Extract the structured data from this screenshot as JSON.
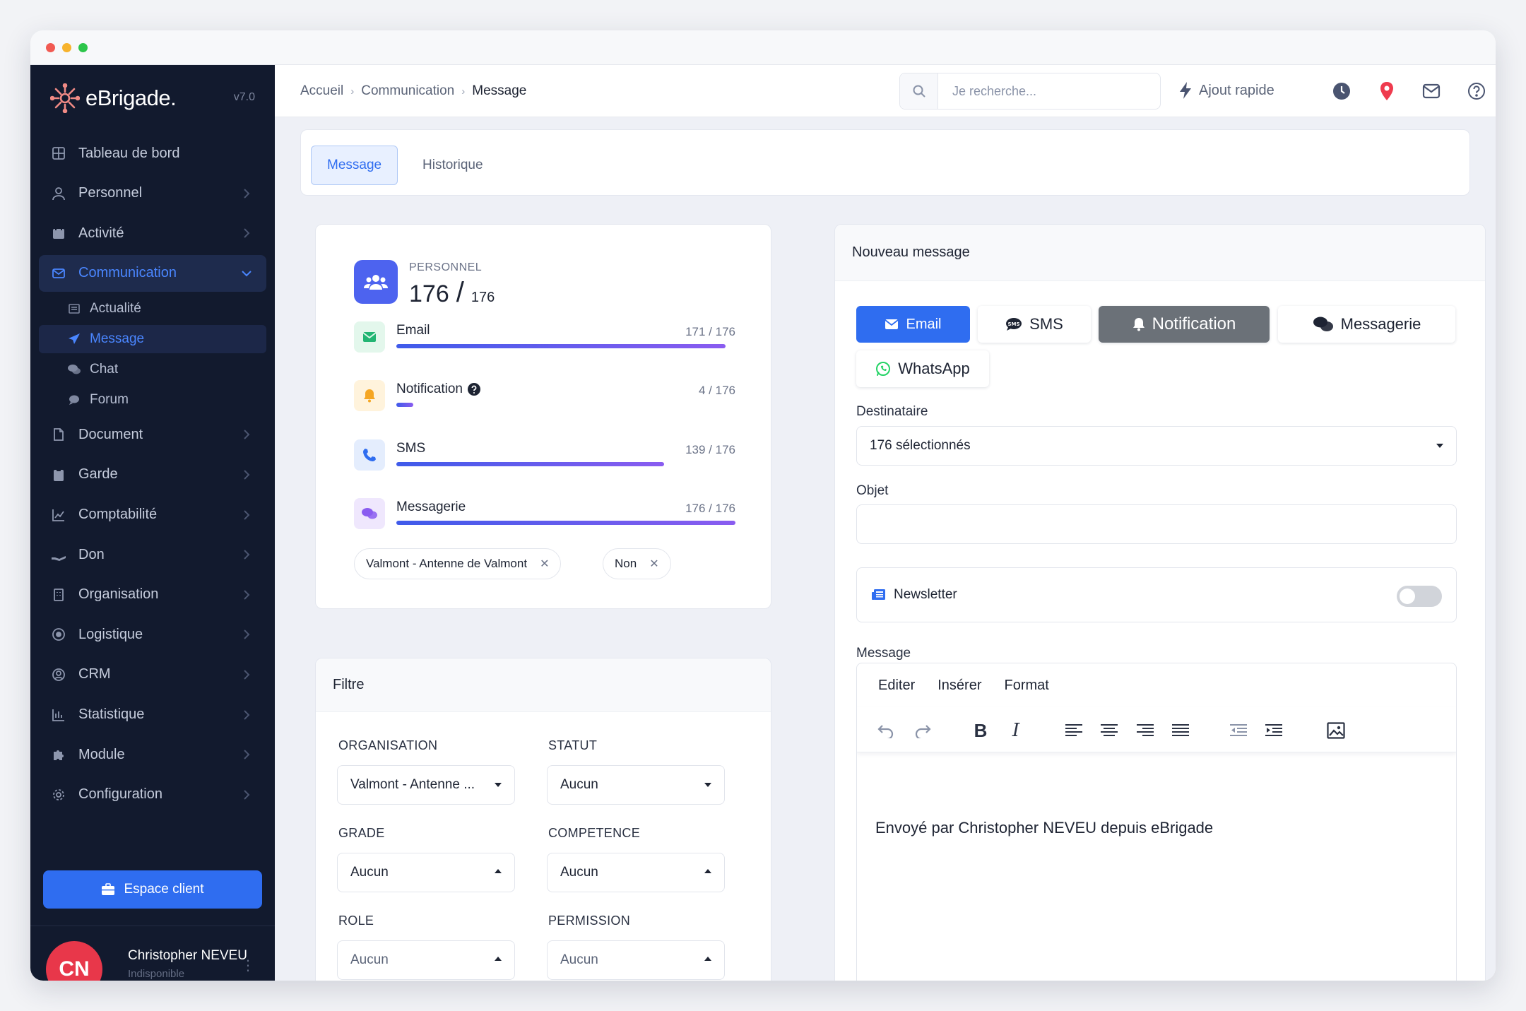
{
  "app": {
    "logo_text": "eBrigade.",
    "version": "v7.0"
  },
  "sidebar": {
    "items": [
      {
        "label": "Tableau de bord"
      },
      {
        "label": "Personnel"
      },
      {
        "label": "Activité"
      },
      {
        "label": "Communication"
      },
      {
        "label": "Document"
      },
      {
        "label": "Garde"
      },
      {
        "label": "Comptabilité"
      },
      {
        "label": "Don"
      },
      {
        "label": "Organisation"
      },
      {
        "label": "Logistique"
      },
      {
        "label": "CRM"
      },
      {
        "label": "Statistique"
      },
      {
        "label": "Module"
      },
      {
        "label": "Configuration"
      }
    ],
    "sub_items": [
      {
        "label": "Actualité"
      },
      {
        "label": "Message"
      },
      {
        "label": "Chat"
      },
      {
        "label": "Forum"
      }
    ],
    "espace_client": "Espace client",
    "user": {
      "initials": "CN",
      "name": "Christopher NEVEU",
      "status": "Indisponible"
    }
  },
  "header": {
    "breadcrumb": [
      "Accueil",
      "Communication",
      "Message"
    ],
    "search_placeholder": "Je recherche...",
    "quick_add": "Ajout rapide"
  },
  "tabs": [
    {
      "label": "Message"
    },
    {
      "label": "Historique"
    }
  ],
  "stats": {
    "label": "PERSONNEL",
    "total": "176",
    "of": "176",
    "rows": [
      {
        "name": "Email",
        "count": "171 / 176",
        "value": 171,
        "max": 176,
        "color": "#22b573"
      },
      {
        "name": "Notification",
        "count": "4 / 176",
        "value": 4,
        "max": 176,
        "color": "#f5a623"
      },
      {
        "name": "SMS",
        "count": "139 / 176",
        "value": 139,
        "max": 176,
        "color": "#2f6df0"
      },
      {
        "name": "Messagerie",
        "count": "176 / 176",
        "value": 176,
        "max": 176,
        "color": "#8a5cf0"
      }
    ],
    "chips": [
      {
        "label": "Valmont - Antenne de Valmont"
      },
      {
        "label": "Non"
      }
    ]
  },
  "filter": {
    "title": "Filtre",
    "fields": [
      {
        "label": "ORGANISATION",
        "value": "Valmont - Antenne ..."
      },
      {
        "label": "STATUT",
        "value": "Aucun"
      },
      {
        "label": "GRADE",
        "value": "Aucun"
      },
      {
        "label": "COMPETENCE",
        "value": "Aucun"
      },
      {
        "label": "ROLE",
        "value": "Aucun"
      },
      {
        "label": "PERMISSION",
        "value": "Aucun"
      }
    ]
  },
  "message": {
    "title": "Nouveau message",
    "channels": [
      {
        "label": "Email"
      },
      {
        "label": "SMS"
      },
      {
        "label": "Notification"
      },
      {
        "label": "Messagerie"
      },
      {
        "label": "WhatsApp"
      }
    ],
    "destinataire_label": "Destinataire",
    "destinataire_value": "176 sélectionnés",
    "objet_label": "Objet",
    "objet_value": "",
    "newsletter_label": "Newsletter",
    "message_label": "Message",
    "editor_menu": [
      "Editer",
      "Insérer",
      "Format"
    ],
    "body_text": "Envoyé par Christopher NEVEU depuis eBrigade"
  }
}
